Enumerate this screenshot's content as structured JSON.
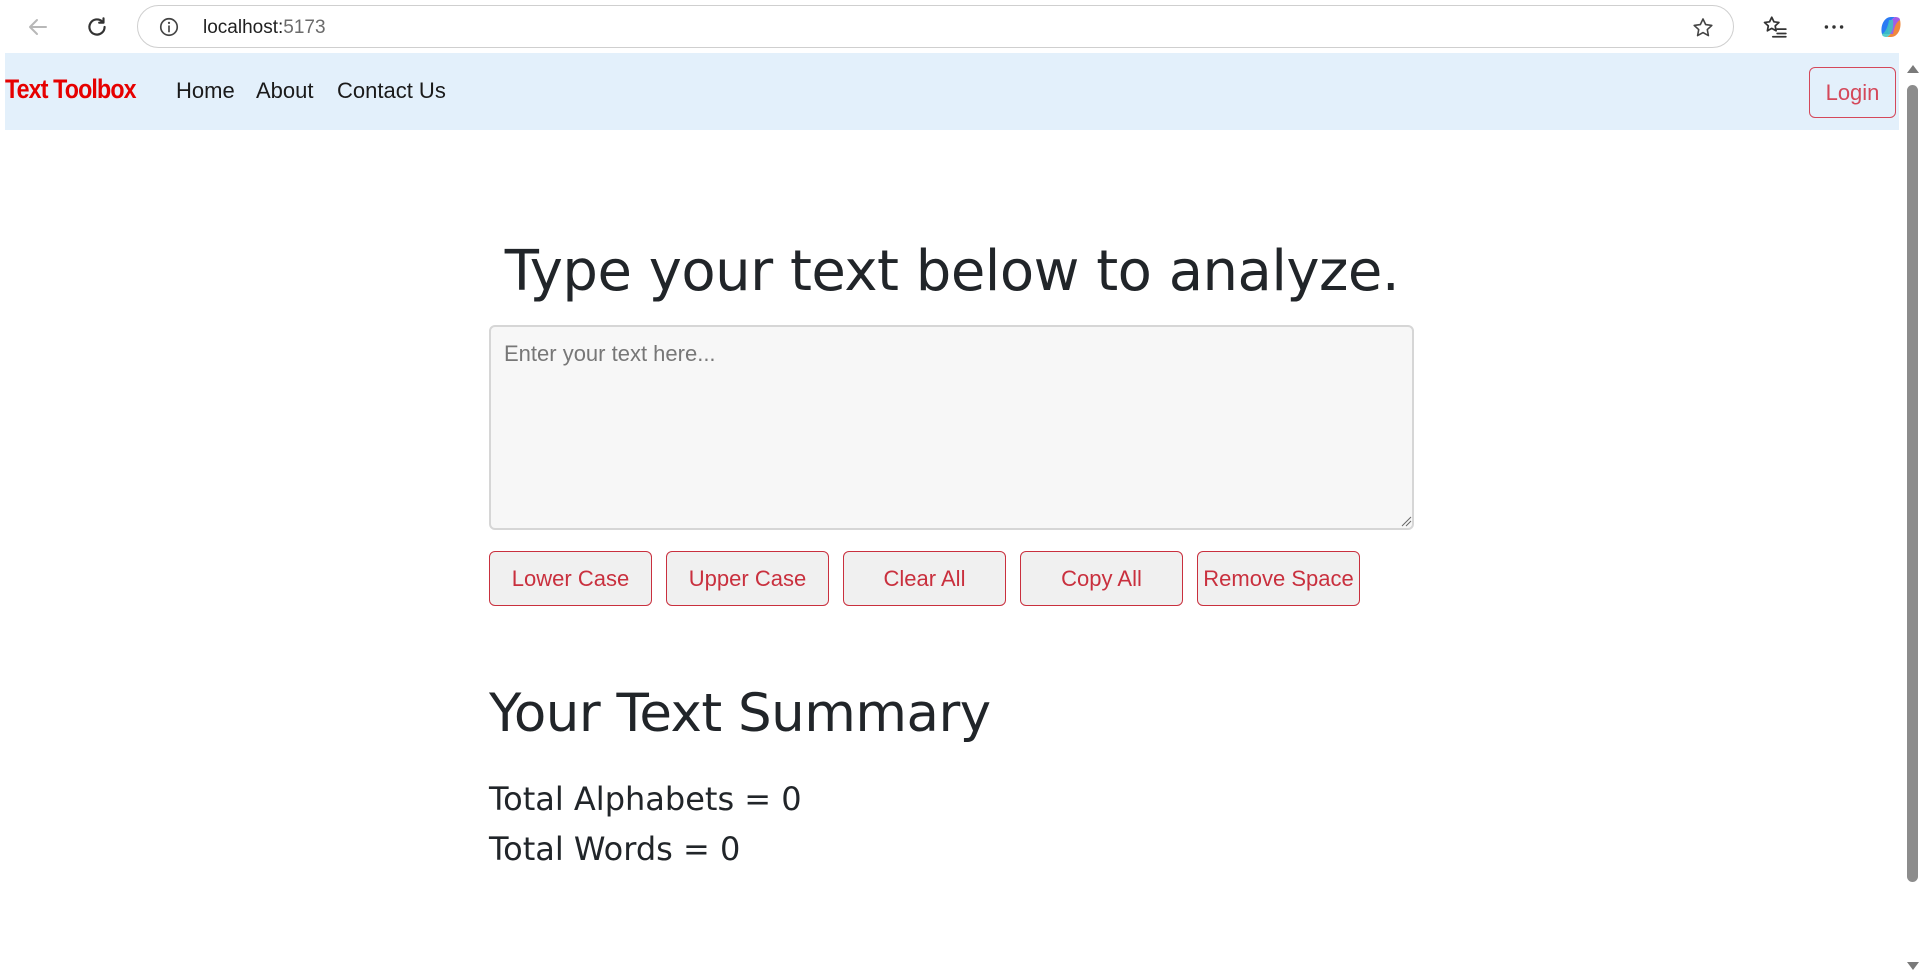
{
  "browser": {
    "url_host": "localhost:",
    "url_port": "5173"
  },
  "navbar": {
    "brand": "Text Toolbox",
    "links": [
      "Home",
      "About",
      "Contact Us"
    ],
    "login_label": "Login",
    "background_color": "#e3f0fb",
    "brand_color": "#e60000"
  },
  "main": {
    "heading": "Type your text below to analyze.",
    "textarea": {
      "value": "",
      "placeholder": "Enter your text here..."
    },
    "buttons": [
      "Lower Case",
      "Upper Case",
      "Clear All",
      "Copy All",
      "Remove Space"
    ],
    "accent_color": "#c9303e"
  },
  "summary": {
    "title": "Your Text Summary",
    "alphabets_line": "Total Alphabets = 0",
    "words_line": "Total Words = 0"
  }
}
